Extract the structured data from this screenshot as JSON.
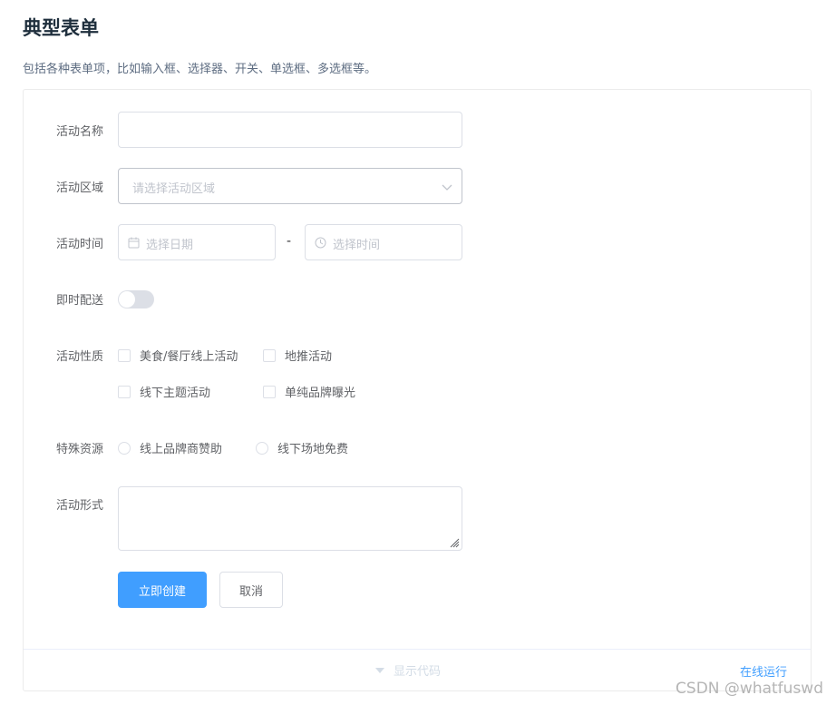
{
  "header": {
    "title": "典型表单",
    "description": "包括各种表单项，比如输入框、选择器、开关、单选框、多选框等。"
  },
  "form": {
    "name": {
      "label": "活动名称",
      "value": ""
    },
    "region": {
      "label": "活动区域",
      "placeholder": "请选择活动区域"
    },
    "time": {
      "label": "活动时间",
      "date_placeholder": "选择日期",
      "separator": "-",
      "time_placeholder": "选择时间"
    },
    "delivery": {
      "label": "即时配送",
      "on": false
    },
    "type": {
      "label": "活动性质",
      "options": [
        "美食/餐厅线上活动",
        "地推活动",
        "线下主题活动",
        "单纯品牌曝光"
      ]
    },
    "resource": {
      "label": "特殊资源",
      "options": [
        "线上品牌商赞助",
        "线下场地免费"
      ]
    },
    "desc": {
      "label": "活动形式",
      "value": ""
    },
    "buttons": {
      "submit": "立即创建",
      "cancel": "取消"
    }
  },
  "footer": {
    "show_code": "显示代码",
    "run_online": "在线运行"
  },
  "watermark": "CSDN @whatfuswd",
  "colors": {
    "primary": "#409eff",
    "border": "#dcdfe6",
    "placeholder": "#c0c4cc"
  }
}
